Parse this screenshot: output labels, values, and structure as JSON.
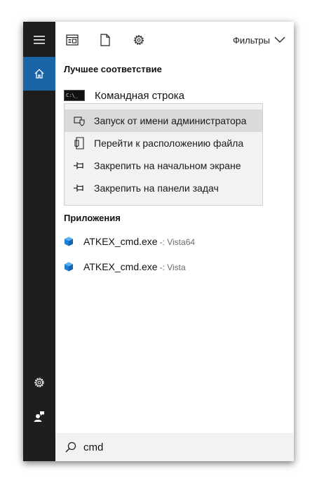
{
  "toolbar": {
    "icons": [
      "apps-icon",
      "document-icon",
      "settings-icon"
    ],
    "filters_label": "Фильтры"
  },
  "best_match": {
    "title": "Лучшее соответствие",
    "item_label": "Командная строка",
    "item_icon_text": "C:\\_"
  },
  "context_menu": {
    "items": [
      {
        "label": "Запуск от имени администратора",
        "icon": "shield-icon"
      },
      {
        "label": "Перейти к расположению файла",
        "icon": "file-location-icon"
      },
      {
        "label": "Закрепить на начальном экране",
        "icon": "pin-icon"
      },
      {
        "label": "Закрепить на панели задач",
        "icon": "pin-icon"
      }
    ]
  },
  "apps": {
    "title": "Приложения",
    "items": [
      {
        "name": "ATKEX_cmd.exe",
        "sub": "-: Vista64"
      },
      {
        "name": "ATKEX_cmd.exe",
        "sub": "-: Vista"
      }
    ]
  },
  "search": {
    "value": "cmd"
  },
  "colors": {
    "accent": "#1b64a8",
    "rail": "#1e1e1e",
    "menu_bg": "#f2f2f2",
    "menu_hover": "#dadada",
    "app_icon": "#1e7fd8"
  }
}
